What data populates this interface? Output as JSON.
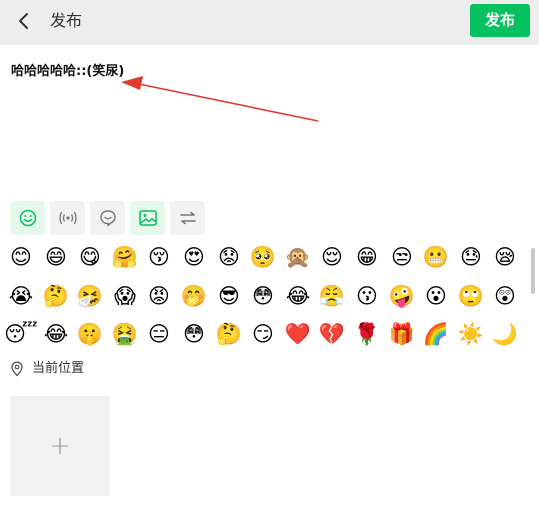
{
  "header": {
    "title": "发布",
    "publish_label": "发布",
    "back_icon": "chevron-left-icon"
  },
  "composer": {
    "text": "哈哈哈哈哈::(笑尿)"
  },
  "toolbar": {
    "tools": [
      {
        "icon": "emoji-icon",
        "active": true
      },
      {
        "icon": "broadcast-icon",
        "active": false
      },
      {
        "icon": "chat-bubble-icon",
        "active": false
      },
      {
        "icon": "image-icon",
        "active": true
      },
      {
        "icon": "swap-icon",
        "active": false
      }
    ]
  },
  "emoji_panel": {
    "rows": [
      [
        "😊",
        "😄",
        "😋",
        "🤗",
        "😚",
        "😍",
        "😟",
        "🥺",
        "🙊",
        "😌",
        "😁",
        "😒",
        "😬",
        "😓",
        "😪"
      ],
      [
        "😭",
        "🤔",
        "🤧",
        "😱",
        "😡",
        "🤭",
        "😎",
        "😳",
        "😂",
        "😤",
        "😗",
        "🤪",
        "😮",
        "🙄",
        "😲"
      ],
      [
        "😴",
        "😂",
        "🤫",
        "🤮",
        "😑",
        "😳",
        "🤔",
        "😏",
        "❤️",
        "💔",
        "🌹",
        "🎁",
        "🌈",
        "☀️",
        "🌙"
      ]
    ]
  },
  "location": {
    "label": "当前位置",
    "icon": "location-pin-icon"
  },
  "add_photo": {
    "label": "+"
  },
  "colors": {
    "accent": "#07c160",
    "header_bg": "#ededed",
    "annotation_arrow": "#e03a2f"
  }
}
